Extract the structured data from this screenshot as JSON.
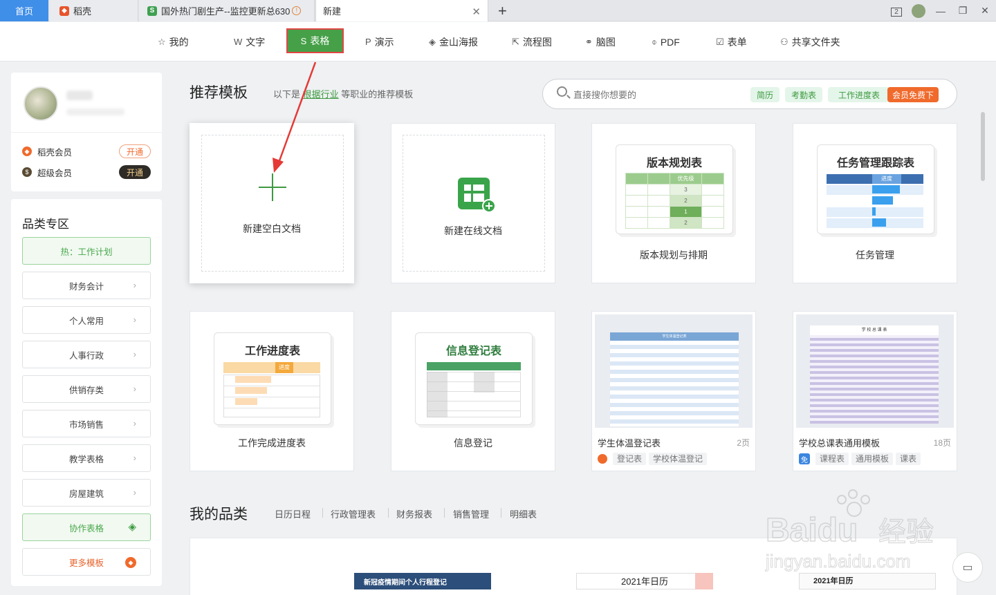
{
  "tabs": [
    {
      "label": "首页"
    },
    {
      "label": "稻壳"
    },
    {
      "label": "国外热门剧生产--监控更新总630"
    },
    {
      "label": "新建"
    }
  ],
  "window": {
    "badge": "2"
  },
  "toolbar": [
    {
      "label": "我的",
      "icon": "star-icon"
    },
    {
      "label": "文字",
      "icon": "w-icon"
    },
    {
      "label": "表格",
      "icon": "s-icon"
    },
    {
      "label": "演示",
      "icon": "p-icon"
    },
    {
      "label": "金山海报",
      "icon": "poster-icon"
    },
    {
      "label": "流程图",
      "icon": "flow-icon"
    },
    {
      "label": "脑图",
      "icon": "mindmap-icon"
    },
    {
      "label": "PDF",
      "icon": "pdf-icon"
    },
    {
      "label": "表单",
      "icon": "form-icon"
    },
    {
      "label": "共享文件夹",
      "icon": "share-folder-icon"
    }
  ],
  "user": {
    "members": [
      {
        "label": "稻壳会员",
        "button": "开通",
        "color": "#f06a2c"
      },
      {
        "label": "超级会员",
        "button": "开通",
        "color": "#5a4a33"
      }
    ]
  },
  "categories": {
    "title": "品类专区",
    "items": [
      "热：工作计划",
      "财务会计",
      "个人常用",
      "人事行政",
      "供销存类",
      "市场销售",
      "教学表格",
      "房屋建筑",
      "协作表格",
      "更多模板"
    ]
  },
  "recommend": {
    "title": "推荐模板",
    "subtitle_prefix": "以下是",
    "subtitle_link": "根据行业",
    "subtitle_suffix": "等职业的推荐模板"
  },
  "search": {
    "placeholder": "直接搜你想要的",
    "chips": [
      "简历",
      "考勤表",
      "工作进度表",
      "会员免费下"
    ]
  },
  "tiles": {
    "blank": "新建空白文档",
    "online": "新建在线文档",
    "t1": {
      "preview_title": "版本规划表",
      "preview_col": "优先级",
      "preview_vals": [
        "3",
        "2",
        "1",
        "2"
      ],
      "label": "版本规划与排期"
    },
    "t2": {
      "preview_title": "任务管理跟踪表",
      "preview_col": "进度",
      "label": "任务管理"
    },
    "t3": {
      "preview_title": "工作进度表",
      "preview_col": "进度",
      "label": "工作完成进度表"
    },
    "t4": {
      "preview_title": "信息登记表",
      "label": "信息登记"
    },
    "t5": {
      "preview_title": "学生体温登记表",
      "label": "学生体温登记表",
      "pages": "2页",
      "tags": [
        "登记表",
        "学校体温登记"
      ]
    },
    "t6": {
      "preview_title": "学 校 总 课 表",
      "label": "学校总课表通用模板",
      "pages": "18页",
      "badge": "免",
      "tags": [
        "课程表",
        "通用模板",
        "课表"
      ]
    }
  },
  "mycat": {
    "title": "我的品类",
    "tabs": [
      "日历日程",
      "行政管理表",
      "财务报表",
      "销售管理",
      "明细表"
    ]
  },
  "bottom": {
    "p1": "新冠疫情期间个人行程登记",
    "p2": "2021年日历",
    "p3": "2021年日历"
  },
  "watermark": {
    "brand": "Baidu",
    "cn": "经验",
    "url": "jingyan.baidu.com"
  }
}
